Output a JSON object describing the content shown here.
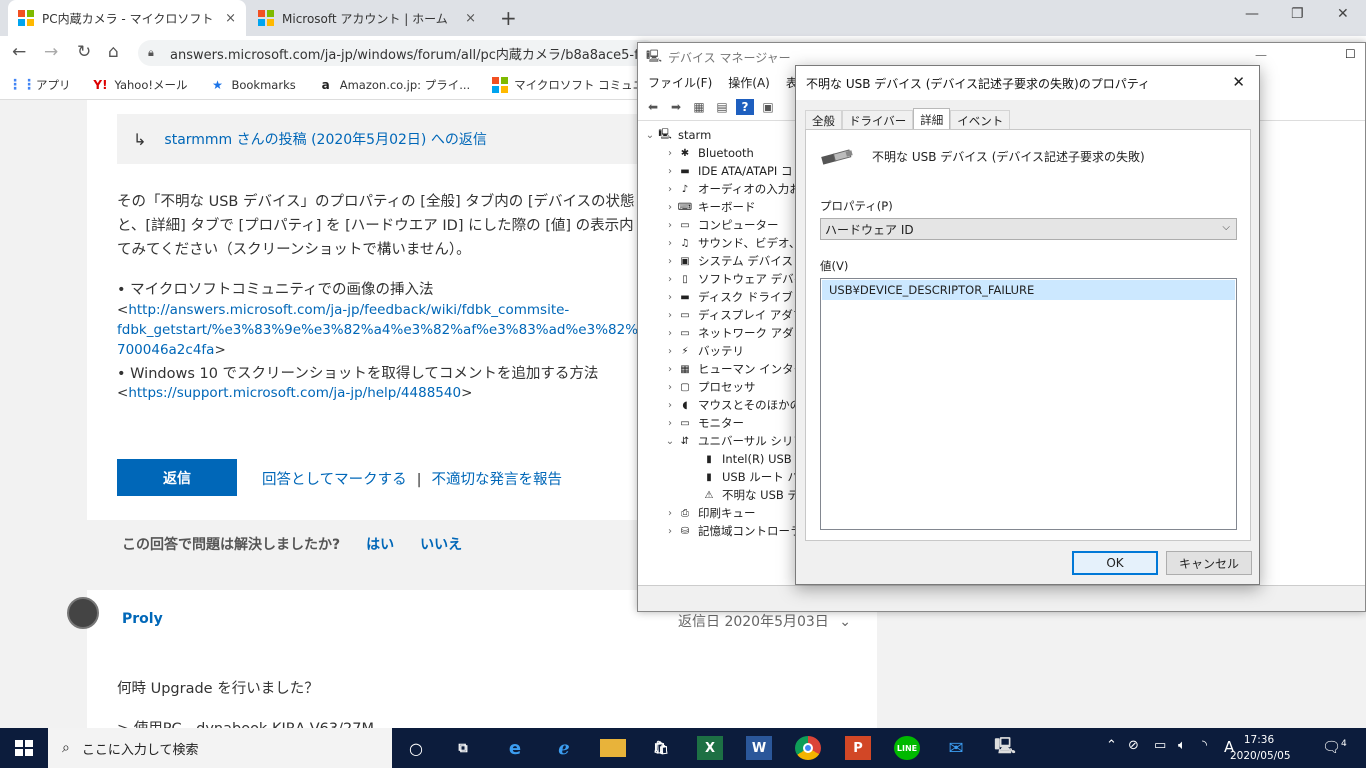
{
  "browser": {
    "tabs": [
      {
        "title": "PC内蔵カメラ - マイクロソフト コミュニティ",
        "close": "×"
      },
      {
        "title": "Microsoft アカウント | ホーム",
        "close": "×"
      }
    ],
    "new_tab": "+",
    "address": "answers.microsoft.com/ja-jp/windows/forum/all/pc内蔵カメラ/b8a8ace5-f9b",
    "bookmarks": [
      {
        "label": "アプリ",
        "icon": "apps-grid-icon"
      },
      {
        "label": "Yahoo!メール",
        "icon": "yahoo-icon"
      },
      {
        "label": "Bookmarks",
        "icon": "star-icon"
      },
      {
        "label": "Amazon.co.jp: プライ...",
        "icon": "amazon-icon"
      },
      {
        "label": "マイクロソフト コミュニティ",
        "icon": "microsoft-logo-icon"
      }
    ]
  },
  "post": {
    "quote": "starmmm さんの投稿 (2020年5月02日) への返信",
    "para1": "その「不明な USB デバイス」のプロパティの [全般] タブ内の [デバイスの状態",
    "para2": "と、[詳細] タブで [プロパティ] を [ハードウエア ID] にした際の [値] の表示内",
    "para3": "てみてください（スクリーンショットで構いません）。",
    "bullet1": "• マイクロソフトコミュニティでの画像の挿入法",
    "link1_a": "http://answers.microsoft.com/ja-jp/feedback/wiki/fdbk_commsite-",
    "link1_b": "fdbk_getstart/%e3%83%9e%e3%82%a4%e3%82%af%e3%83%ad%e3%82%bd/",
    "link1_c": "700046a2c4fa",
    "bullet2": "• Windows 10 でスクリーンショットを取得してコメントを追加する方法",
    "link2": "https://support.microsoft.com/ja-jp/help/4488540",
    "reply_button": "返信",
    "mark_answer": "回答としてマークする",
    "report": "不適切な発言を報告",
    "helpful_q": "この回答で問題は解決しましたか?",
    "yes": "はい",
    "no": "いいえ"
  },
  "next_post": {
    "author": "Proly",
    "date": "返信日 2020年5月03日",
    "text1": "何時 Upgrade を行いました？",
    "text2": "> 使用PC　dynabook  KIRA V63/27M"
  },
  "device_manager": {
    "title": "デバイス マネージャー",
    "menu": [
      "ファイル(F)",
      "操作(A)",
      "表示("
    ],
    "root": "starm",
    "items": [
      "Bluetooth",
      "IDE ATA/ATAPI コ",
      "オーディオの入力およ",
      "キーボード",
      "コンピューター",
      "サウンド、ビデオ、およ",
      "システム デバイス",
      "ソフトウェア デバイス",
      "ディスク ドライブ",
      "ディスプレイ アダプター",
      "ネットワーク アダプター",
      "バッテリ",
      "ヒューマン インターフェ",
      "プロセッサ",
      "マウスとそのほかのポ",
      "モニター",
      "ユニバーサル シリアル"
    ],
    "usb_children": [
      "Intel(R) USB 3.",
      "USB ルート ハブ",
      "不明な USB デバ"
    ],
    "after": [
      "印刷キュー",
      "記憶域コントローラー"
    ]
  },
  "properties": {
    "title": "不明な USB デバイス (デバイス記述子要求の失敗)のプロパティ",
    "tabs": [
      "全般",
      "ドライバー",
      "詳細",
      "イベント"
    ],
    "active_tab": "詳細",
    "device_name": "不明な USB デバイス (デバイス記述子要求の失敗)",
    "property_label": "プロパティ(P)",
    "property_value": "ハードウェア ID",
    "value_label": "値(V)",
    "value_item": "USB¥DEVICE_DESCRIPTOR_FAILURE",
    "ok": "OK",
    "cancel": "キャンセル"
  },
  "taskbar": {
    "search_placeholder": "ここに入力して検索",
    "time": "17:36",
    "date": "2020/05/05",
    "ime": "A",
    "notifications": "4"
  }
}
